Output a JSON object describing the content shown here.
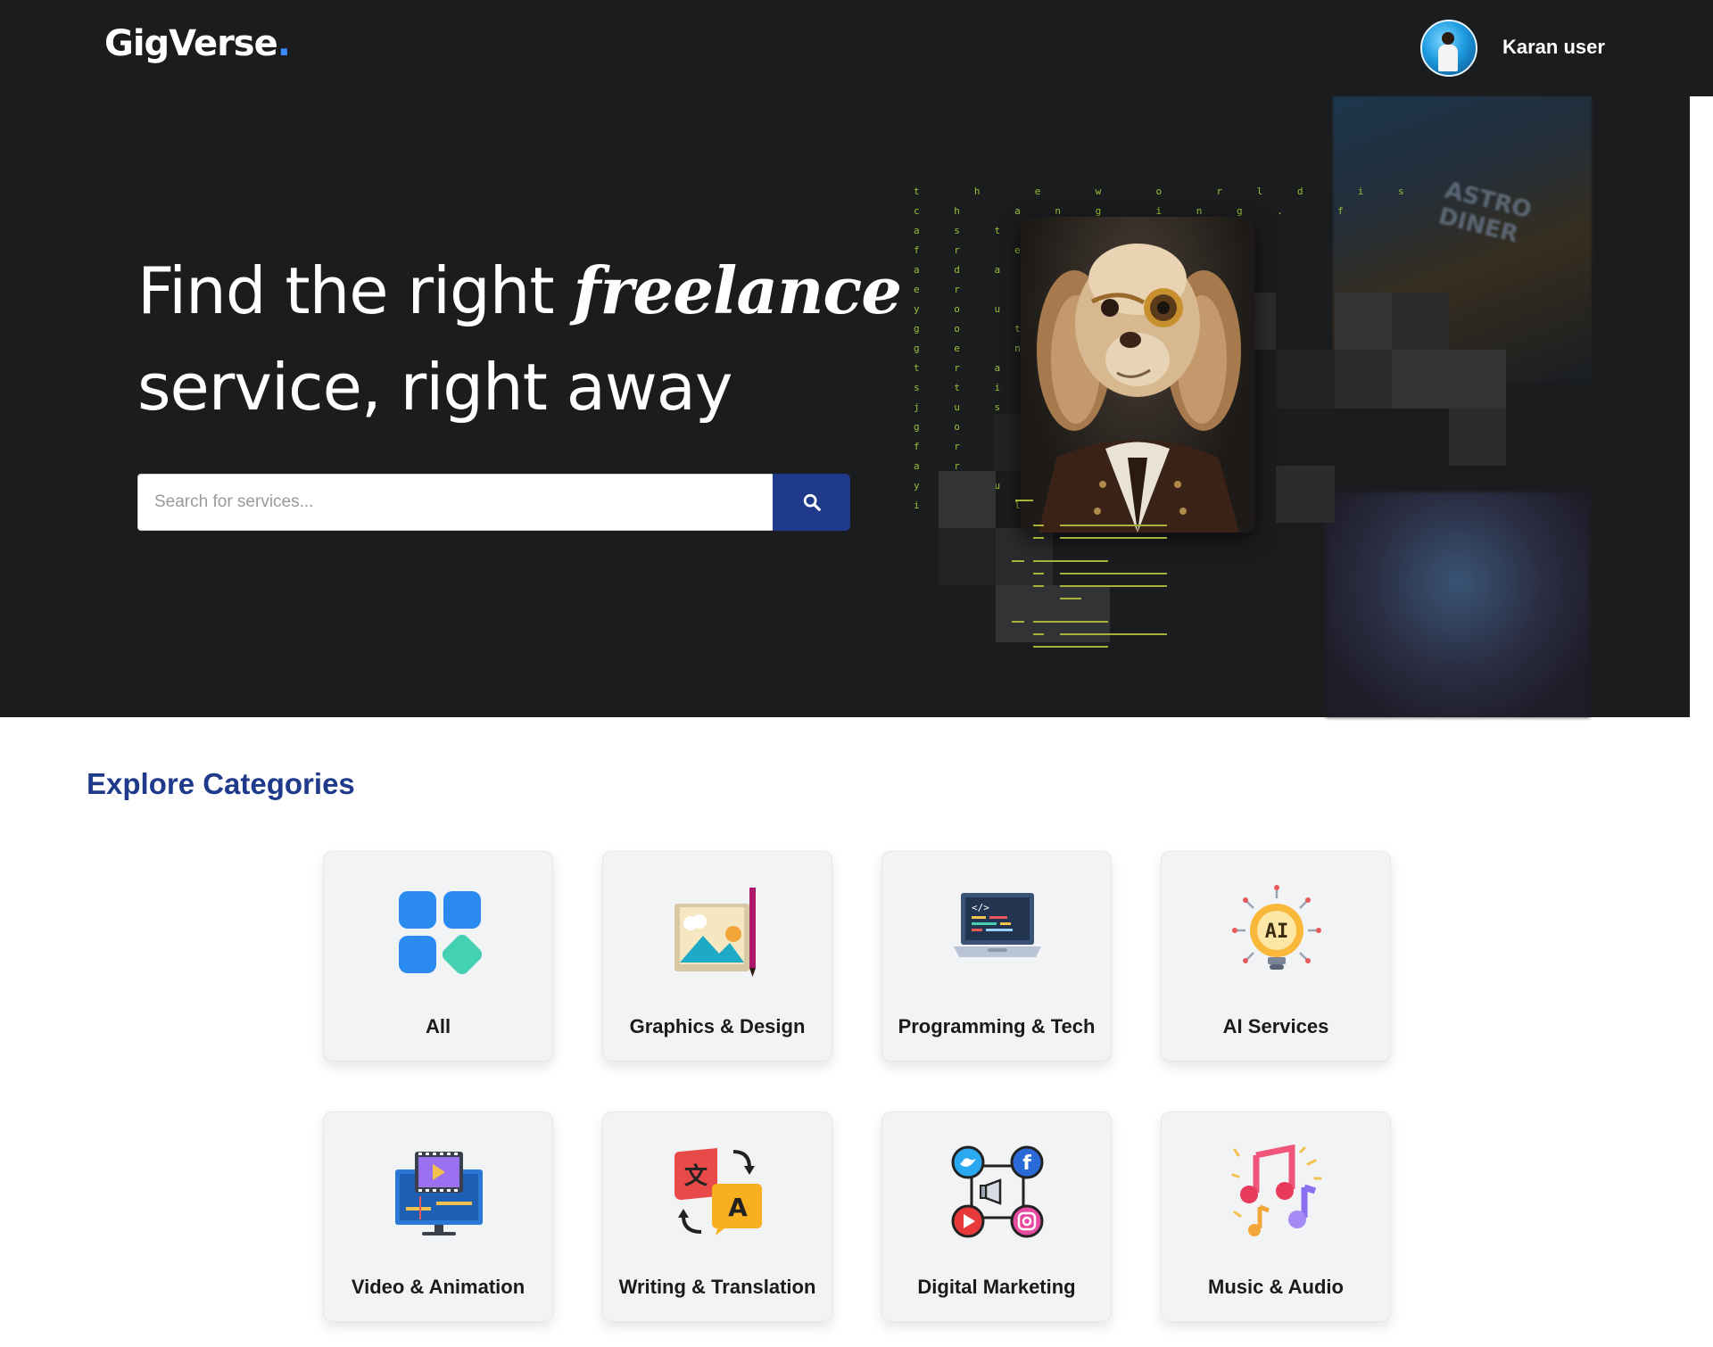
{
  "header": {
    "logo_text": "GigVerse",
    "logo_dot": ".",
    "user_name": "Karan user"
  },
  "hero": {
    "headline_line1_start": "Find the right ",
    "headline_italic": "freelance",
    "headline_line2": "service, right away",
    "search_placeholder": "Search for services...",
    "search_value": "",
    "matrix_text": "t  h  e  w  o  r l d  i s\nc h  a n g  i n g .  f\na s t\nf r  e e\na d a p t\ne r\ny o u ' v e\ng o  t t\ng e  n e\nt r a i n\ns t i l l\nj u s t\ng o ,\nf r e e\na r e\ny o u  n\ni t  l",
    "neon_sign": "ASTRO DINER"
  },
  "categories": {
    "title": "Explore Categories",
    "items": [
      {
        "label": "All",
        "icon": "grid-icon"
      },
      {
        "label": "Graphics & Design",
        "icon": "picture-pen-icon"
      },
      {
        "label": "Programming & Tech",
        "icon": "laptop-code-icon"
      },
      {
        "label": "AI Services",
        "icon": "ai-bulb-icon"
      },
      {
        "label": "Video & Animation",
        "icon": "video-editor-icon"
      },
      {
        "label": "Writing & Translation",
        "icon": "translate-icon"
      },
      {
        "label": "Digital Marketing",
        "icon": "social-media-icon"
      },
      {
        "label": "Music & Audio",
        "icon": "music-notes-icon"
      }
    ]
  },
  "colors": {
    "hero_bg": "#1b1c1e",
    "brand_blue": "#1f3a8a",
    "logo_dot": "#3d8bff",
    "matrix_green": "#9bbf3a"
  }
}
